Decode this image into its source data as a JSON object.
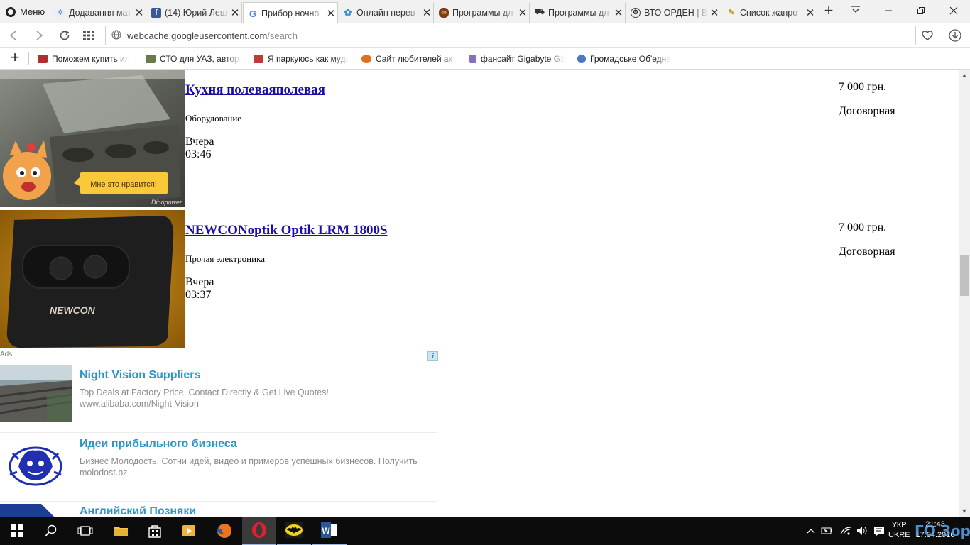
{
  "browser": {
    "menu_label": "Меню",
    "tabs": [
      {
        "title": "Додавання мат",
        "icon": "circle-logo-icon"
      },
      {
        "title": "(14) Юрий Леш",
        "icon": "facebook-icon"
      },
      {
        "title": "Прибор ночно",
        "icon": "google-icon",
        "active": true
      },
      {
        "title": "Онлайн перев",
        "icon": "translate-icon"
      },
      {
        "title": "Программы дл",
        "icon": "goggles-icon"
      },
      {
        "title": "Программы дл",
        "icon": "car-icon"
      },
      {
        "title": "ВТО ОРДЕН | В",
        "icon": "vto-icon"
      },
      {
        "title": "Список жанро",
        "icon": "pencil-icon"
      }
    ],
    "url_host": "webcache.googleusercontent.com",
    "url_path": "/search",
    "bookmarks": [
      {
        "title": "Поможем купить ил",
        "icon": "car-icon"
      },
      {
        "title": "СТО для УАЗ, автора",
        "icon": "uaz-icon"
      },
      {
        "title": "Я паркуюсь как муда",
        "icon": "car-icon"
      },
      {
        "title": "Сайт любителей акт",
        "icon": "fish-icon"
      },
      {
        "title": "фансайт Gigabyte GS",
        "icon": "phone-icon"
      },
      {
        "title": "Громадське Об'една",
        "icon": "shield-icon"
      }
    ]
  },
  "listings": [
    {
      "title": "Кухня полеваяполевая",
      "category": "Оборудование",
      "date": "Вчера",
      "time": "03:46",
      "price": "7 000 грн.",
      "negotiable": "Договорная",
      "sticker_text": "Мне это нравится!",
      "watermark": "Dinopower"
    },
    {
      "title": "NEWCONoptik Optik LRM 1800S",
      "category": "Прочая электроника",
      "date": "Вчера",
      "time": "03:37",
      "price": "7 000 грн.",
      "negotiable": "Договорная",
      "device_brand": "NEWCON"
    }
  ],
  "ads": {
    "label": "Ads",
    "info_icon": "i",
    "items": [
      {
        "title": "Night Vision Suppliers",
        "description": "Top Deals at Factory Price. Contact Directly & Get Live Quotes!",
        "url": "www.alibaba.com/Night-Vision"
      },
      {
        "title": "Идеи прибыльного бизнеса",
        "description": "Бизнес Молодость. Сотни идей, видео и примеров успешных бизнесов. Получить",
        "url": "molodost.bz"
      },
      {
        "title": "Английский Позняки",
        "description": "",
        "url": ""
      }
    ]
  },
  "taskbar": {
    "lang_top": "УКР",
    "lang_bottom": "UKRE",
    "time": "21:43",
    "date": "17.04.2016",
    "watermark_text": "ГО Зоряна"
  },
  "colors": {
    "link": "#1a0dab",
    "ad_title": "#2996c7",
    "taskbar": "#0c0c0c"
  }
}
